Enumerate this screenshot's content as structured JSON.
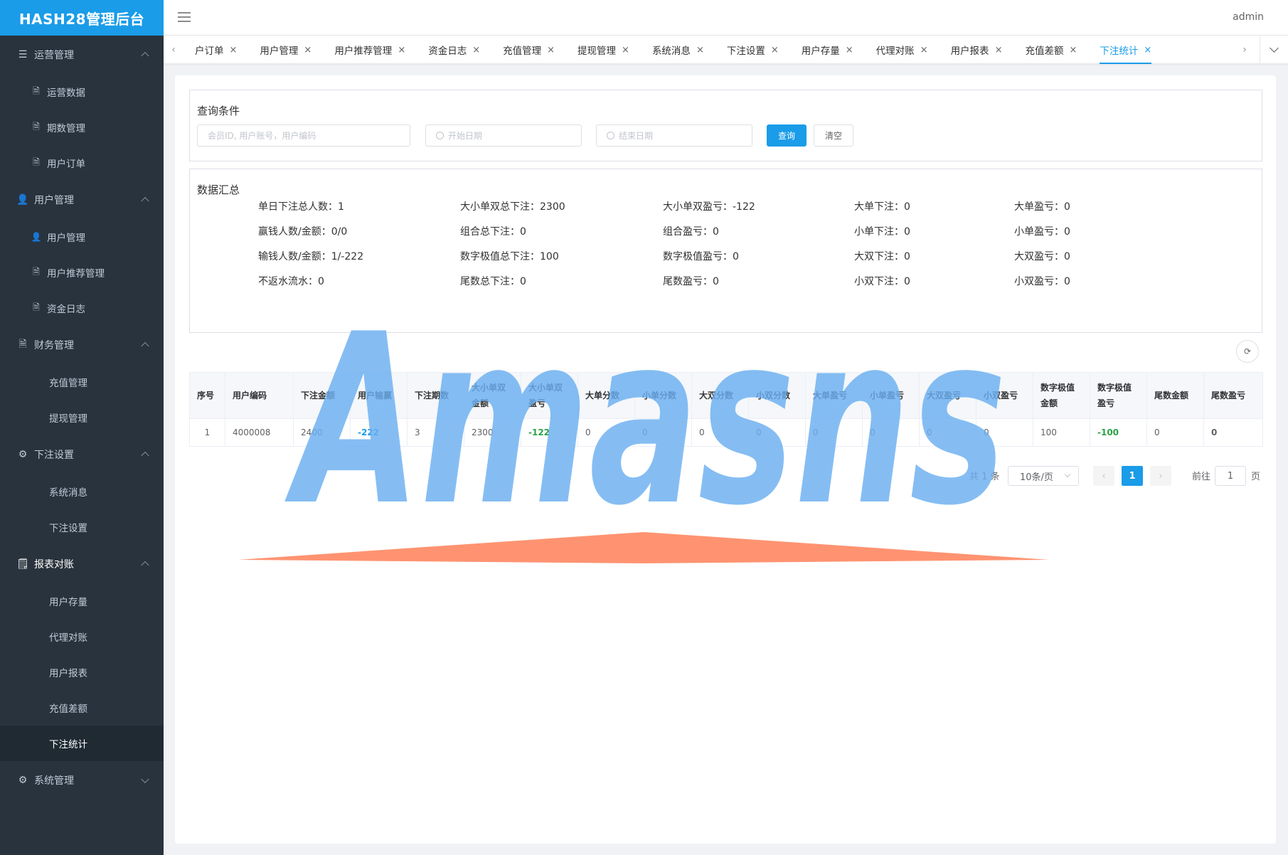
{
  "sidebar": {
    "logo": "HASH28管理后台",
    "groups": [
      {
        "label": "运营管理",
        "items": [
          "运营数据",
          "期数管理",
          "用户订单"
        ]
      },
      {
        "label": "用户管理",
        "items": [
          "用户管理",
          "用户推荐管理",
          "资金日志"
        ]
      },
      {
        "label": "财务管理",
        "items": [
          "充值管理",
          "提现管理"
        ]
      },
      {
        "label": "下注设置",
        "items": [
          "系统消息",
          "下注设置"
        ]
      },
      {
        "label": "报表对账",
        "items": [
          "用户存量",
          "代理对账",
          "用户报表",
          "充值差额",
          "下注统计"
        ]
      },
      {
        "label": "系统管理",
        "items": []
      }
    ]
  },
  "topbar": {
    "user": "admin"
  },
  "tabs": [
    "户订单",
    "用户管理",
    "用户推荐管理",
    "资金日志",
    "充值管理",
    "提现管理",
    "系统消息",
    "下注设置",
    "用户存量",
    "代理对账",
    "用户报表",
    "充值差额",
    "下注统计"
  ],
  "tab_close": "×",
  "tab_arrows": {
    "left": "‹",
    "right": "›"
  },
  "query": {
    "title": "查询条件",
    "member_placeholder": "会员ID, 用户账号，用户编码",
    "start_placeholder": "开始日期",
    "end_placeholder": "结束日期",
    "search_btn": "查询",
    "clear_btn": "清空"
  },
  "summary": {
    "title": "数据汇总",
    "rows": [
      [
        "单日下注总人数：1",
        "大小单双总下注：2300",
        "大小单双盈亏：-122",
        "大单下注：0",
        "大单盈亏：0"
      ],
      [
        "赢钱人数/金额：0/0",
        "组合总下注：0",
        "组合盈亏：0",
        "小单下注：0",
        "小单盈亏：0"
      ],
      [
        "输钱人数/金额：1/-222",
        "数字极值总下注：100",
        "数字极值盈亏：0",
        "大双下注：0",
        "大双盈亏：0"
      ],
      [
        "不返水流水：0",
        "尾数总下注：0",
        "尾数盈亏：0",
        "小双下注：0",
        "小双盈亏：0"
      ]
    ]
  },
  "table": {
    "headers": [
      [
        "序号"
      ],
      [
        "用户编码"
      ],
      [
        "下注金额"
      ],
      [
        "用户输赢"
      ],
      [
        "下注期数"
      ],
      [
        "大小单双",
        "金额"
      ],
      [
        "大小单双",
        "盈亏"
      ],
      [
        "大单分数"
      ],
      [
        "小单分数"
      ],
      [
        "大双分数"
      ],
      [
        "小双分数"
      ],
      [
        "大单盈亏"
      ],
      [
        "小单盈亏"
      ],
      [
        "大双盈亏"
      ],
      [
        "小双盈亏"
      ],
      [
        "数字极值",
        "金额"
      ],
      [
        "数字极值",
        "盈亏"
      ],
      [
        "尾数金额"
      ],
      [
        "尾数盈亏"
      ]
    ],
    "rows": [
      [
        "1",
        "4000008",
        "2400",
        "-222",
        "3",
        "2300",
        "-122",
        "0",
        "0",
        "0",
        "0",
        "0",
        "0",
        "0",
        "0",
        "100",
        "-100",
        "0",
        "0"
      ]
    ]
  },
  "pagination": {
    "total": "共 1 条",
    "page_size": "10条/页",
    "prev": "‹",
    "current": "1",
    "next": "›",
    "goto_label": "前往",
    "goto_value": "1",
    "page_suffix": "页"
  },
  "watermark": {
    "text": "Amasns",
    "color": "#6aaff0",
    "accent": "#ff8a65"
  },
  "colors": {
    "accent": "#1a9ce8",
    "sidebar_bg": "#29333d",
    "positive": "#2ba245"
  }
}
